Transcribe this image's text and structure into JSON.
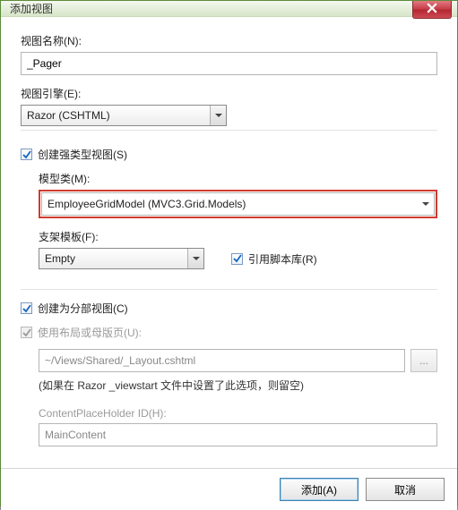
{
  "window": {
    "title": "添加视图",
    "close_icon": "close"
  },
  "view_name": {
    "label": "视图名称(N):",
    "value": "_Pager"
  },
  "view_engine": {
    "label": "视图引擎(E):",
    "selected": "Razor (CSHTML)"
  },
  "strongly_typed": {
    "label": "创建强类型视图(S)",
    "checked": true
  },
  "model_class": {
    "label": "模型类(M):",
    "selected": "EmployeeGridModel (MVC3.Grid.Models)"
  },
  "scaffold": {
    "label": "支架模板(F):",
    "selected": "Empty"
  },
  "ref_scripts": {
    "label": "引用脚本库(R)",
    "checked": true
  },
  "partial": {
    "label": "创建为分部视图(C)",
    "checked": true
  },
  "use_layout": {
    "label": "使用布局或母版页(U):",
    "checked": true,
    "disabled": true
  },
  "layout_path": {
    "value": "~/Views/Shared/_Layout.cshtml"
  },
  "layout_hint": "(如果在 Razor _viewstart 文件中设置了此选项，则留空)",
  "cph": {
    "label": "ContentPlaceHolder ID(H):",
    "value": "MainContent"
  },
  "buttons": {
    "ok": "添加(A)",
    "cancel": "取消"
  },
  "browse_dots": "..."
}
